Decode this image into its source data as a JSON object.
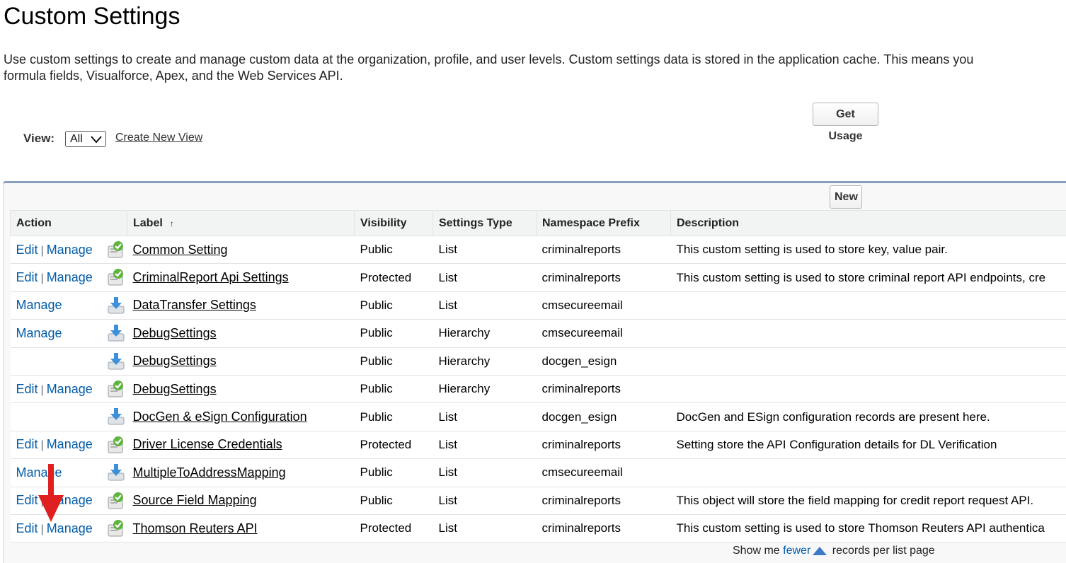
{
  "page": {
    "title": "Custom Settings",
    "intro_line1": "Use custom settings to create and manage custom data at the organization, profile, and user levels. Custom settings data is stored in the application cache. This means you",
    "intro_line2": "formula fields, Visualforce, Apex, and the Web Services API."
  },
  "toolbar": {
    "get_usage_label": "Get Usage",
    "view_label": "View:",
    "view_selected": "All",
    "create_new_view": "Create New View",
    "new_label": "New"
  },
  "table": {
    "headers": {
      "action": "Action",
      "label": "Label",
      "label_sort": "↑",
      "visibility": "Visibility",
      "settings_type": "Settings Type",
      "namespace_prefix": "Namespace Prefix",
      "description": "Description"
    },
    "edit_label": "Edit",
    "manage_label": "Manage",
    "separator": "|",
    "rows": [
      {
        "label": "Common Setting",
        "visibility": "Public",
        "type": "List",
        "namespace": "criminalreports",
        "description": "This custom setting is used to store key, value pair.",
        "icon": "check-icon"
      },
      {
        "label": "CriminalReport Api Settings",
        "visibility": "Protected",
        "type": "List",
        "namespace": "criminalreports",
        "description": "This custom setting is used to store criminal report API endpoints, cre",
        "icon": "check-icon"
      },
      {
        "label": "DataTransfer Settings",
        "visibility": "Public",
        "type": "List",
        "namespace": "cmsecureemail",
        "description": "",
        "icon": "download-icon"
      },
      {
        "label": "DebugSettings",
        "visibility": "Public",
        "type": "Hierarchy",
        "namespace": "cmsecureemail",
        "description": "",
        "icon": "download-icon"
      },
      {
        "label": "DebugSettings",
        "visibility": "Public",
        "type": "Hierarchy",
        "namespace": "docgen_esign",
        "description": "",
        "icon": "download-icon"
      },
      {
        "label": "DebugSettings",
        "visibility": "Public",
        "type": "Hierarchy",
        "namespace": "criminalreports",
        "description": "",
        "icon": "check-icon"
      },
      {
        "label": "DocGen & eSign Configuration",
        "visibility": "Public",
        "type": "List",
        "namespace": "docgen_esign",
        "description": "DocGen and ESign configuration records are present here.",
        "icon": "download-icon"
      },
      {
        "label": "Driver License Credentials",
        "visibility": "Protected",
        "type": "List",
        "namespace": "criminalreports",
        "description": "Setting store the API Configuration details for DL Verification",
        "icon": "check-icon"
      },
      {
        "label": "MultipleToAddressMapping",
        "visibility": "Public",
        "type": "List",
        "namespace": "cmsecureemail",
        "description": "",
        "icon": "download-icon"
      },
      {
        "label": "Source Field Mapping",
        "visibility": "Public",
        "type": "List",
        "namespace": "criminalreports",
        "description": "This object will store the field mapping for credit report request API.",
        "icon": "check-icon"
      },
      {
        "label": "Thomson Reuters API",
        "visibility": "Protected",
        "type": "List",
        "namespace": "criminalreports",
        "description": "This custom setting is used to store Thomson Reuters API authentica",
        "icon": "check-icon"
      }
    ]
  },
  "footer": {
    "prefix": "Show me",
    "fewer": "fewer",
    "suffix": "records per list page"
  },
  "colors": {
    "link": "#015ba7",
    "panel_border": "#8a9ebe",
    "annotation_arrow": "#e02020"
  }
}
